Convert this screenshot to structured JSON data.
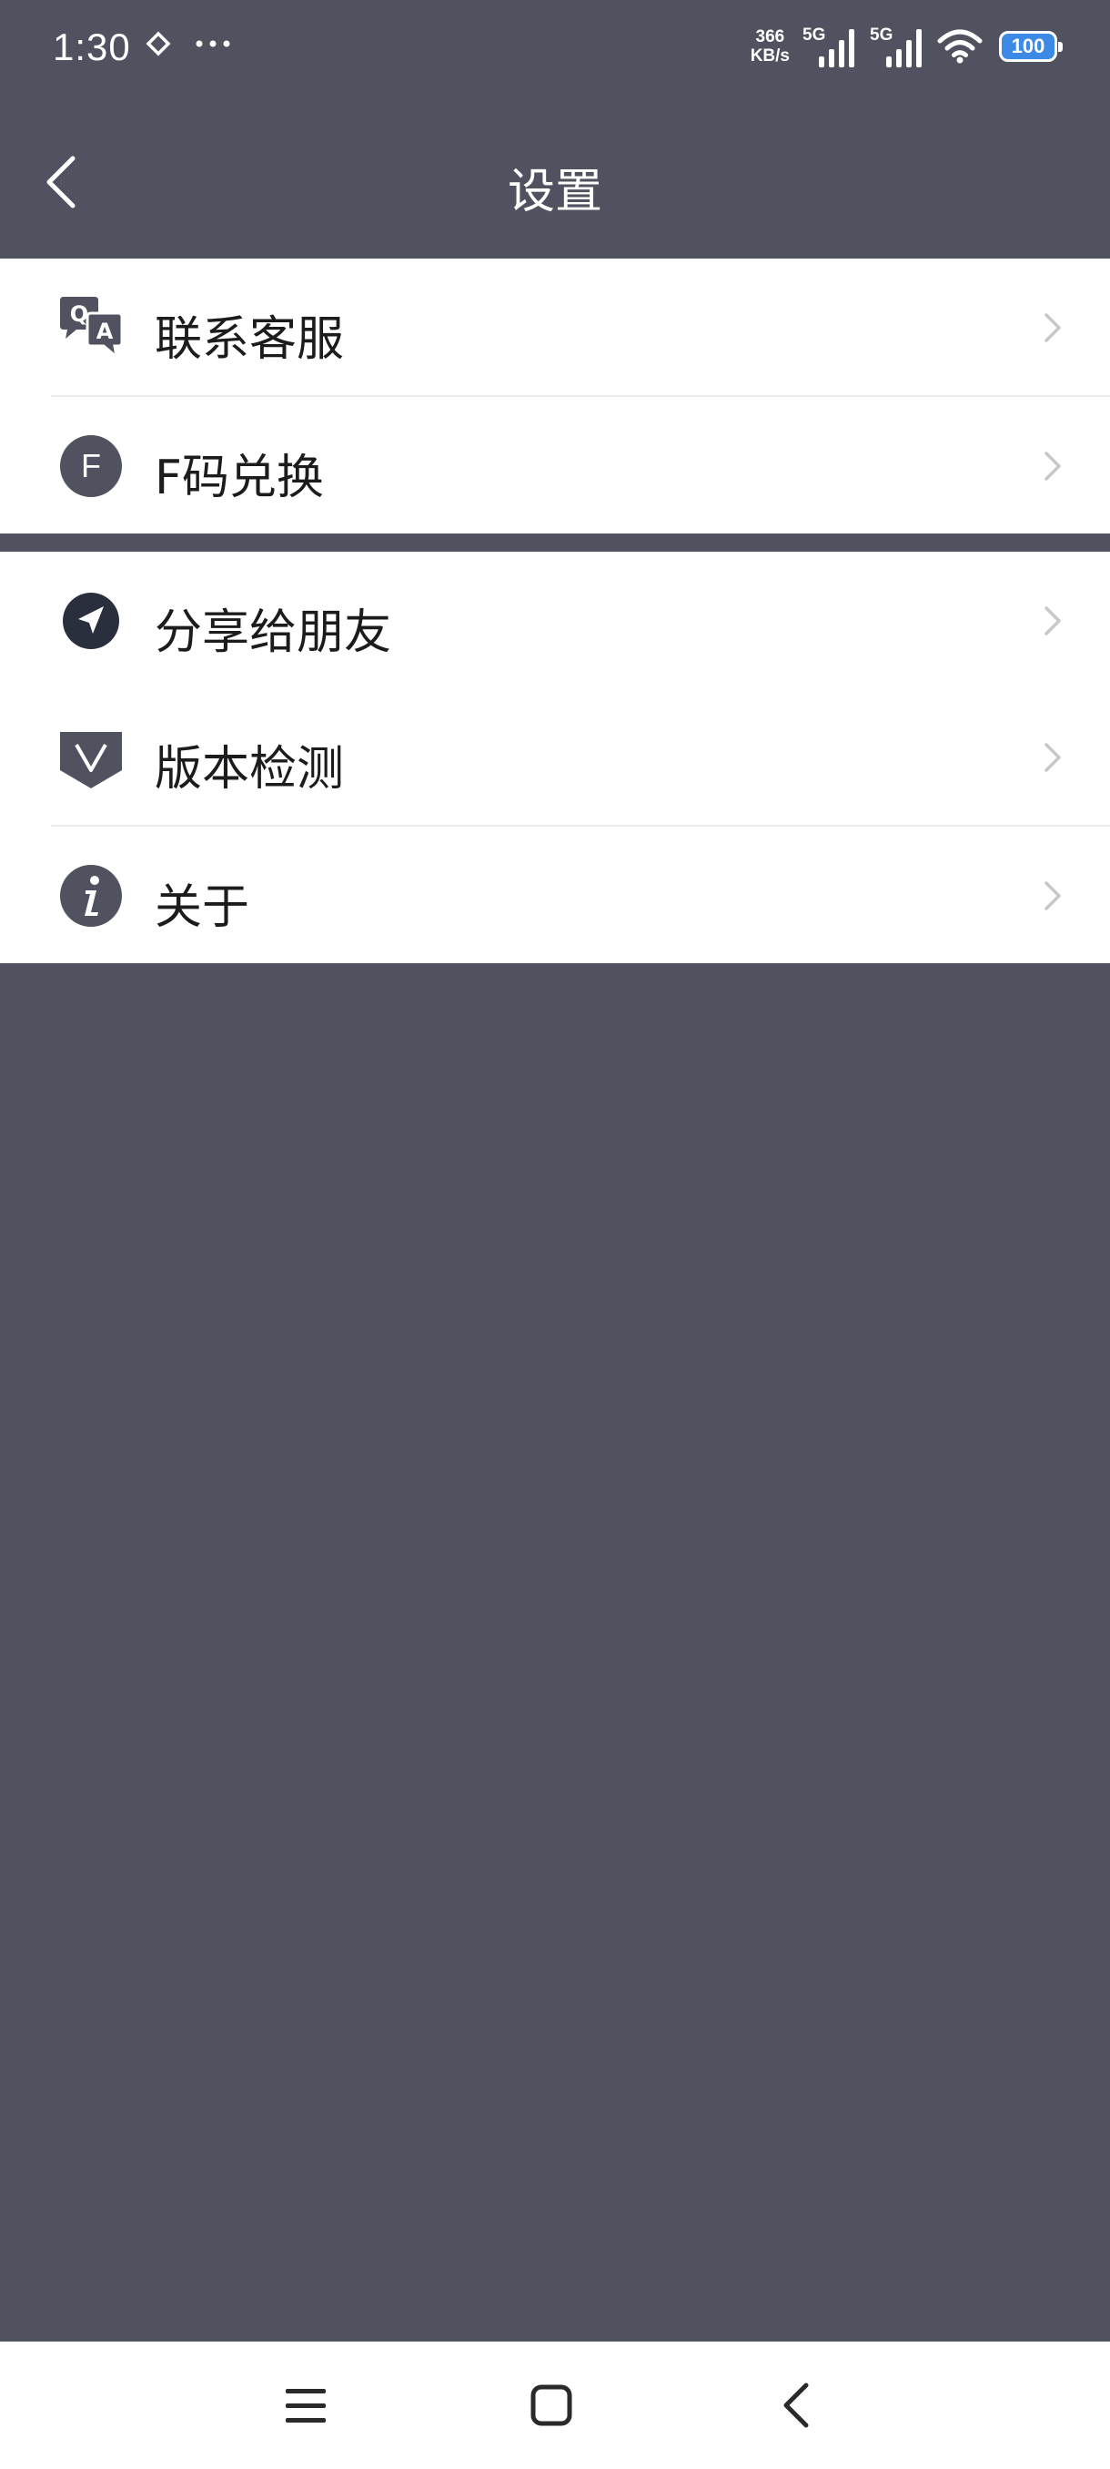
{
  "status_bar": {
    "time": "1:30",
    "speed_value": "366",
    "speed_unit": "KB/s",
    "sim1": "5G",
    "sim2": "5G",
    "battery": "100"
  },
  "header": {
    "title": "设置"
  },
  "sections": [
    {
      "items": [
        {
          "label": "联系客服",
          "icon": "qa-chat-icon"
        },
        {
          "label": "F码兑换",
          "icon": "f-code-icon"
        }
      ]
    },
    {
      "items": [
        {
          "label": "分享给朋友",
          "icon": "share-arrow-icon"
        },
        {
          "label": "版本检测",
          "icon": "version-v-icon"
        },
        {
          "label": "关于",
          "icon": "info-icon"
        }
      ]
    }
  ],
  "colors": {
    "background": "#50525F",
    "card": "#FFFFFF",
    "icon": "#50525F",
    "chevron": "#C7C7CC",
    "text": "#1C1C1E"
  },
  "nav_bar": {
    "icons": [
      "menu-icon",
      "home-square-icon",
      "back-triangle-icon"
    ]
  }
}
